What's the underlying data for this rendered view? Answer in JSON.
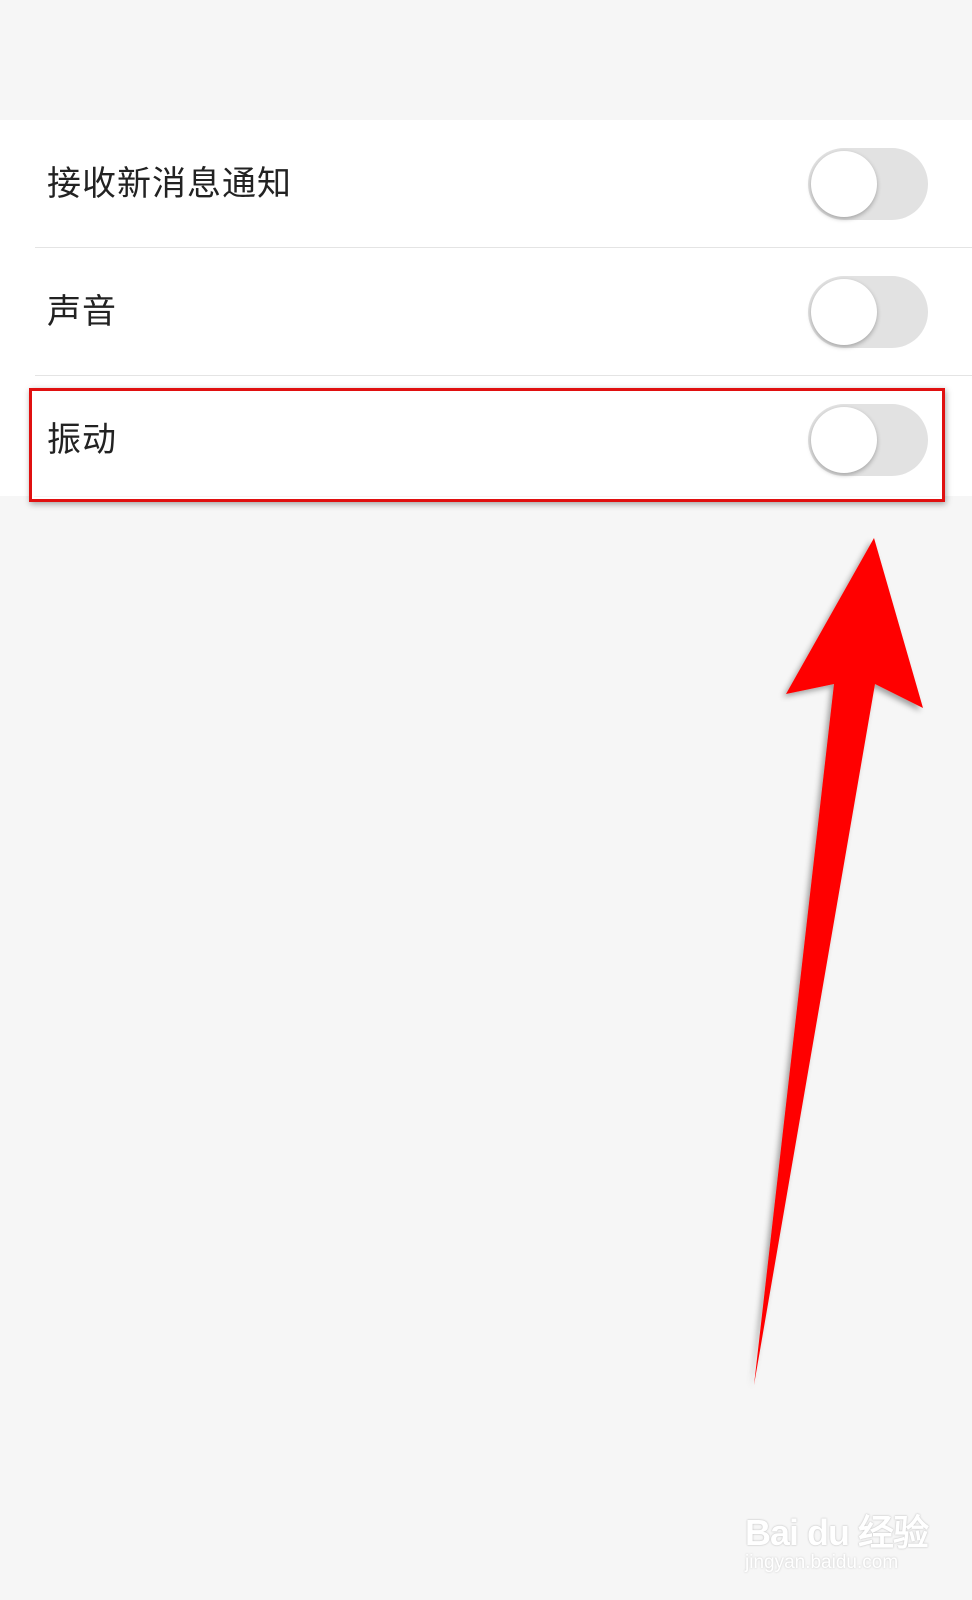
{
  "settings": {
    "items": [
      {
        "label": "接收新消息通知",
        "enabled": false
      },
      {
        "label": "声音",
        "enabled": false
      },
      {
        "label": "振动",
        "enabled": false
      }
    ]
  },
  "annotation": {
    "highlight_color": "#e01010",
    "arrow_color": "#ff0000"
  },
  "watermark": {
    "logo": "Bai du 经验",
    "url": "jingyan.baidu.com"
  }
}
